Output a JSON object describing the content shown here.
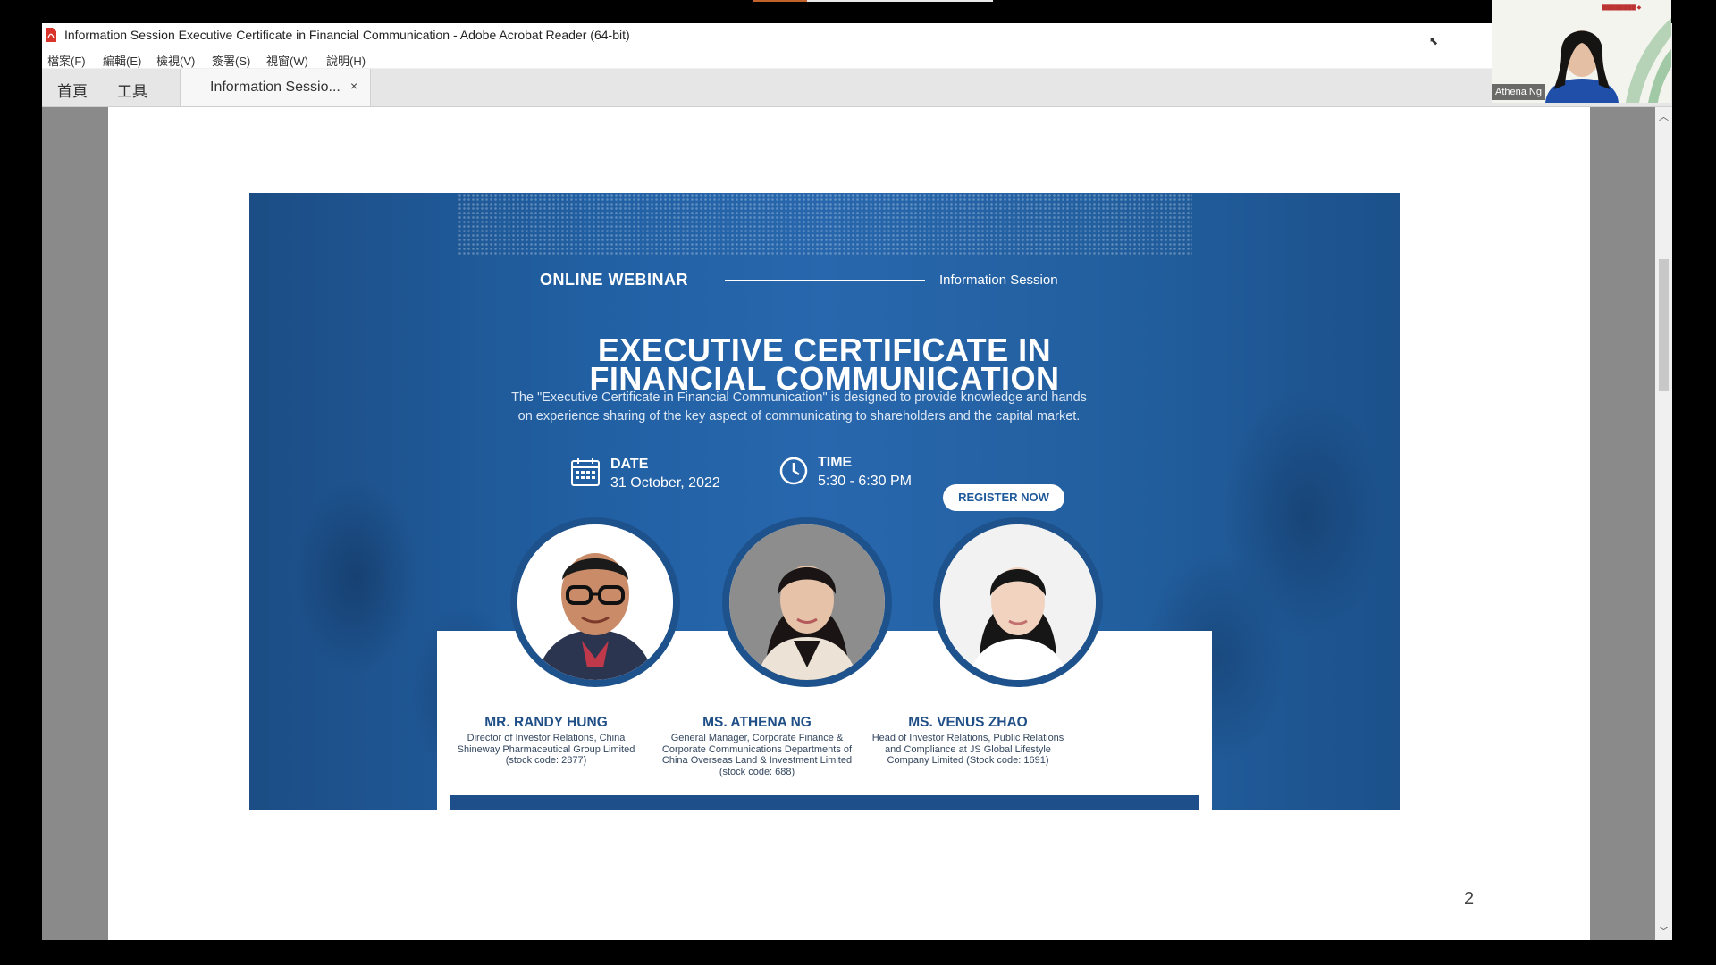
{
  "window": {
    "title": "Information Session  Executive Certificate in  Financial Communication - Adobe Acrobat Reader (64-bit)"
  },
  "menu": [
    "檔案(F)",
    "編輯(E)",
    "檢視(V)",
    "簽署(S)",
    "視窗(W)",
    "說明(H)"
  ],
  "tabs": {
    "home": "首頁",
    "tools": "工具",
    "document": "Information Sessio...",
    "close": "×"
  },
  "page_number": "2",
  "slide": {
    "online": "ONLINE WEBINAR",
    "info": "Information Session",
    "title_line1": "EXECUTIVE CERTIFICATE IN",
    "title_line2": "FINANCIAL COMMUNICATION",
    "description": "The \"Executive Certificate in Financial Communication\" is designed to provide knowledge and hands on experience sharing of the key aspect of communicating to shareholders and the capital market.",
    "date_label": "DATE",
    "date_value": "31 October, 2022",
    "time_label": "TIME",
    "time_value": "5:30 - 6:30 PM",
    "register": "REGISTER NOW",
    "speakers": [
      {
        "name": "MR. RANDY HUNG",
        "role": "Director of Investor Relations, China Shineway Pharmaceutical Group Limited (stock code: 2877)"
      },
      {
        "name": "MS. ATHENA NG",
        "role": "General Manager, Corporate Finance & Corporate Communications Departments of China Overseas Land & Investment Limited (stock code: 688)"
      },
      {
        "name": "MS. VENUS ZHAO",
        "role": "Head of Investor Relations, Public Relations and Compliance at JS Global Lifestyle Company Limited (Stock code: 1691)"
      }
    ]
  },
  "video": {
    "participant": "Athena Ng"
  },
  "colors": {
    "slide_blue": "#2160a3",
    "dark_blue": "#1e528c",
    "acrobat_red": "#d9342b"
  }
}
